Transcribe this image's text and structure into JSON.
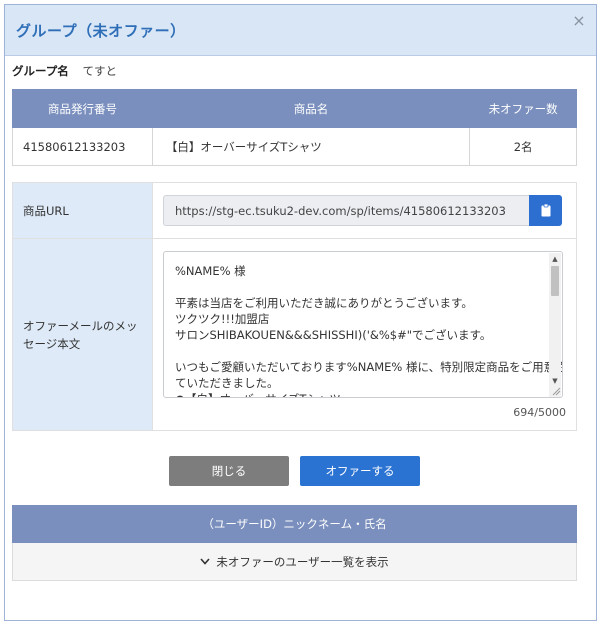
{
  "modal": {
    "title": "グループ（未オファー）",
    "close_glyph": "×"
  },
  "group": {
    "label": "グループ名",
    "value": "てすと"
  },
  "product_table": {
    "headers": [
      "商品発行番号",
      "商品名",
      "未オファー数"
    ],
    "rows": [
      [
        "41580612133203",
        "【白】オーバーサイズTシャツ",
        "2名"
      ]
    ]
  },
  "form": {
    "url_label": "商品URL",
    "url_value": "https://stg-ec.tsuku2-dev.com/sp/items/41580612133203",
    "message_label": "オファーメールのメッセージ本文",
    "message_text": "%NAME% 様\n\n平素は当店をご利用いただき誠にありがとうございます。\nツクツク!!!加盟店\nサロンSHIBAKOUEN&&&SHISSHI)('&%$#\"でございます。\n\nいつもご愛顧いただいております%NAME% 様に、特別限定商品をご用意させ\nていただきました。\n●【白】オーバーサイズTシャツ",
    "counter": "694/5000"
  },
  "buttons": {
    "close_label": "閉じる",
    "offer_label": "オファーする"
  },
  "users": {
    "header": "（ユーザーID）ニックネーム・氏名",
    "toggle_label": "未オファーのユーザー一覧を表示"
  },
  "colors": {
    "header_bg": "#d8e6f6",
    "title": "#2f6fb8",
    "table_header": "#7a8fbd",
    "primary": "#2b73d3",
    "secondary": "#7d7d7d",
    "label_bg": "#deeaf7"
  },
  "icons": {
    "copy": "clipboard-icon",
    "close": "close-icon",
    "toggle": "chevron-down-icon"
  }
}
